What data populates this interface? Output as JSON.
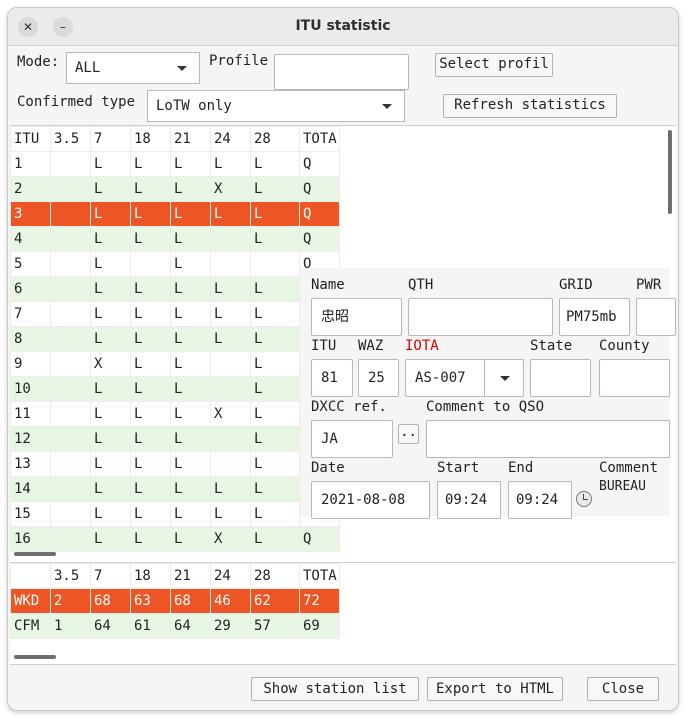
{
  "window": {
    "title": "ITU statistic"
  },
  "controls": {
    "mode_label": "Mode:",
    "mode_value": "ALL",
    "profile_label": "Profile",
    "profile_value": "",
    "select_profile_button": "Select profil",
    "confirmed_type_label": "Confirmed type",
    "confirmed_type_value": "LoTW only",
    "refresh_button": "Refresh statistics"
  },
  "table": {
    "headers": [
      "ITU",
      "3.5",
      "7",
      "18",
      "21",
      "24",
      "28",
      "TOTA"
    ],
    "rows": [
      [
        "1",
        "",
        "L",
        "L",
        "L",
        "L",
        "L",
        "Q"
      ],
      [
        "2",
        "",
        "L",
        "L",
        "L",
        "X",
        "L",
        "Q"
      ],
      [
        "3",
        "",
        "L",
        "L",
        "L",
        "L",
        "L",
        "Q"
      ],
      [
        "4",
        "",
        "L",
        "L",
        "L",
        "",
        "L",
        "Q"
      ],
      [
        "5",
        "",
        "L",
        "",
        "L",
        "",
        "",
        "O"
      ],
      [
        "6",
        "",
        "L",
        "L",
        "L",
        "L",
        "L",
        ""
      ],
      [
        "7",
        "",
        "L",
        "L",
        "L",
        "L",
        "L",
        ""
      ],
      [
        "8",
        "",
        "L",
        "L",
        "L",
        "L",
        "L",
        ""
      ],
      [
        "9",
        "",
        "X",
        "L",
        "L",
        "",
        "L",
        ""
      ],
      [
        "10",
        "",
        "L",
        "L",
        "L",
        "",
        "L",
        ""
      ],
      [
        "11",
        "",
        "L",
        "L",
        "L",
        "X",
        "L",
        ""
      ],
      [
        "12",
        "",
        "L",
        "L",
        "L",
        "",
        "L",
        ""
      ],
      [
        "13",
        "",
        "L",
        "L",
        "L",
        "",
        "L",
        ""
      ],
      [
        "14",
        "",
        "L",
        "L",
        "L",
        "L",
        "L",
        ""
      ],
      [
        "15",
        "",
        "L",
        "L",
        "L",
        "L",
        "L",
        ""
      ],
      [
        "16",
        "",
        "L",
        "L",
        "L",
        "X",
        "L",
        "Q"
      ]
    ],
    "selected_row": "3"
  },
  "summary": {
    "headers": [
      "",
      "3.5",
      "7",
      "18",
      "21",
      "24",
      "28",
      "TOTA"
    ],
    "rows": [
      [
        "WKD",
        "2",
        "68",
        "63",
        "68",
        "46",
        "62",
        "72"
      ],
      [
        "CFM",
        "1",
        "64",
        "61",
        "64",
        "29",
        "57",
        "69"
      ]
    ]
  },
  "qso_popup": {
    "name_label": "Name",
    "name_value": "忠昭",
    "qth_label": "QTH",
    "qth_value": "",
    "grid_label": "GRID",
    "grid_value": "PM75mb",
    "pwr_label": "PWR",
    "pwr_value": "",
    "itu_label": "ITU",
    "itu_value": "81",
    "waz_label": "WAZ",
    "waz_value": "25",
    "iota_label": "IOTA",
    "iota_value": "AS-007",
    "state_label": "State",
    "state_value": "",
    "county_label": "County",
    "county_value": "",
    "dxcc_label": "DXCC ref.",
    "dxcc_value": "JA",
    "dxcc_button": "..",
    "comment_qso_label": "Comment to QSO",
    "comment_qso_value": "",
    "date_label": "Date",
    "date_value": "2021-08-08",
    "start_label": "Start",
    "start_value": "09:24",
    "end_label": "End",
    "end_value": "09:24",
    "comment_label": "Comment",
    "comment_value": "BUREAU"
  },
  "footer": {
    "show_station_list": "Show station list",
    "export_html": "Export to HTML",
    "close": "Close"
  },
  "colors": {
    "selected_row": "#ed5624",
    "stripe_green": "#e8f7e3",
    "iota_label": "#e00000"
  }
}
